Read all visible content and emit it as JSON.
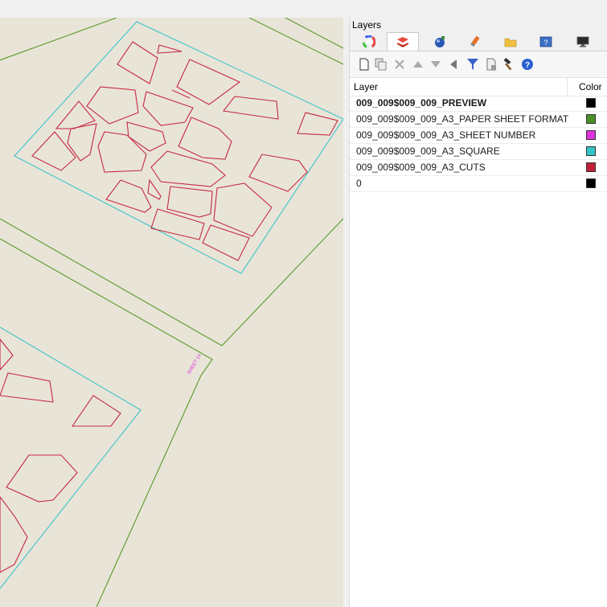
{
  "panel": {
    "title": "Layers",
    "tabs": [
      {
        "icon": "color-wheel-icon",
        "active": false
      },
      {
        "icon": "layers-icon",
        "active": true
      },
      {
        "icon": "material-sphere-icon",
        "active": false
      },
      {
        "icon": "paint-tube-icon",
        "active": false
      },
      {
        "icon": "folder-icon",
        "active": false
      },
      {
        "icon": "help-window-icon",
        "active": false
      },
      {
        "icon": "display-icon",
        "active": false
      }
    ],
    "toolbar": [
      {
        "icon": "new-layer-icon"
      },
      {
        "icon": "new-sublayer-icon"
      },
      {
        "icon": "delete-icon"
      },
      {
        "icon": "move-up-icon"
      },
      {
        "icon": "move-down-icon"
      },
      {
        "icon": "move-parent-icon"
      },
      {
        "icon": "filter-icon"
      },
      {
        "icon": "copy-layer-icon"
      },
      {
        "icon": "tools-icon"
      },
      {
        "icon": "help-icon"
      }
    ],
    "columns": {
      "layer": "Layer",
      "color": "Color"
    },
    "rows": [
      {
        "name": "009_009$009_009_PREVIEW",
        "color": "#000000",
        "bold": true
      },
      {
        "name": "009_009$009_009_A3_PAPER SHEET FORMAT",
        "color": "#4e8c2c",
        "bold": false
      },
      {
        "name": "009_009$009_009_A3_SHEET NUMBER",
        "color": "#e033e0",
        "bold": false
      },
      {
        "name": "009_009$009_009_A3_SQUARE",
        "color": "#33c4c4",
        "bold": false
      },
      {
        "name": "009_009$009_009_A3_CUTS",
        "color": "#c41e3a",
        "bold": false
      },
      {
        "name": "0",
        "color": "#000000",
        "bold": false
      }
    ]
  },
  "viewport": {
    "sheet_label": "SHEET 14",
    "colors": {
      "background": "#e9e4d8",
      "paper": "#5a9a2a",
      "square": "#3cc4c8",
      "cuts": "#c42a40",
      "label": "#e033e0"
    }
  }
}
